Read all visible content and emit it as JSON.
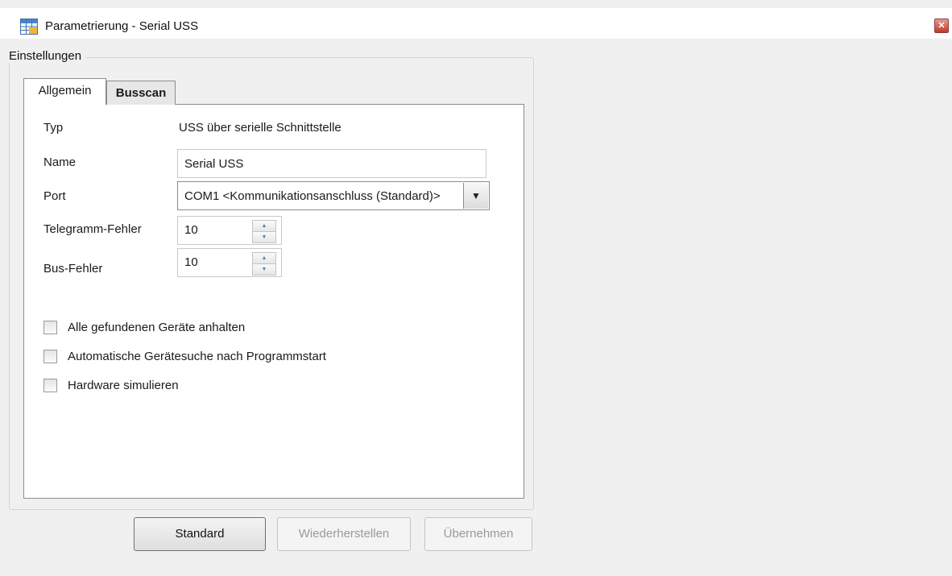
{
  "window": {
    "title": "Parametrierung - Serial USS",
    "icon": "table-grid-icon",
    "close_icon": "close-icon",
    "close_symbol": "✕"
  },
  "groupbox": {
    "label": "Einstellungen"
  },
  "tabs": [
    {
      "label": "Allgemein",
      "active": true
    },
    {
      "label": "Busscan",
      "active": false
    }
  ],
  "form": {
    "type_label": "Typ",
    "type_value": "USS über serielle Schnittstelle",
    "name_label": "Name",
    "name_value": "Serial USS",
    "port_label": "Port",
    "port_value": "COM1 <Kommunikationsanschluss (Standard)>",
    "port_dropdown_symbol": "▼",
    "telegram_error_label": "Telegramm-Fehler",
    "telegram_error_value": "10",
    "bus_error_label": "Bus-Fehler",
    "bus_error_value": "10",
    "spin_up_symbol": "▲",
    "spin_down_symbol": "▼"
  },
  "checkboxes": [
    {
      "label": "Alle gefundenen Geräte anhalten",
      "checked": false
    },
    {
      "label": "Automatische Gerätesuche nach Programmstart",
      "checked": false
    },
    {
      "label": "Hardware simulieren",
      "checked": false
    }
  ],
  "buttons": {
    "standard": "Standard",
    "restore": "Wiederherstellen",
    "apply": "Übernehmen"
  },
  "colors": {
    "window_bg": "#f0f0f0",
    "panel_bg": "#ffffff",
    "border": "#8d8d8d",
    "disabled_text": "#9a9a9a",
    "close_red": "#c0392b"
  }
}
